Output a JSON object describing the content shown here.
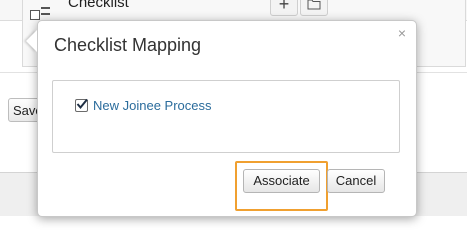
{
  "background": {
    "section_label": "Checklist",
    "add_button_glyph": "+",
    "save_label": "Save"
  },
  "modal": {
    "title": "Checklist Mapping",
    "close_glyph": "×",
    "items": [
      {
        "label": "New Joinee Process",
        "checked": true
      }
    ],
    "associate_label": "Associate",
    "cancel_label": "Cancel",
    "highlight_color": "#f0a030"
  },
  "icons": [
    "checklist-icon",
    "plus-icon",
    "folder-icon",
    "close-icon",
    "checkmark-icon"
  ]
}
